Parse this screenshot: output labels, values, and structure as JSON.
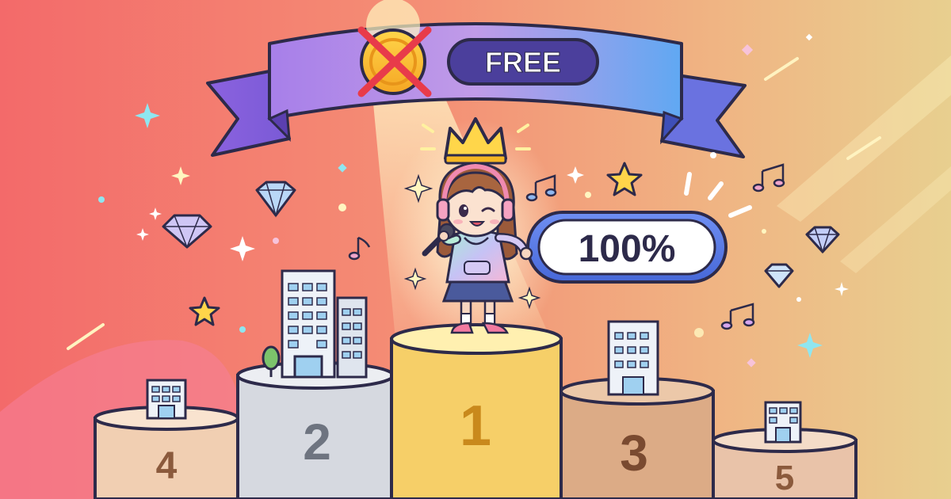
{
  "banner": {
    "coin_status": "crossed-out",
    "free_label": "FREE"
  },
  "rate_badge": {
    "value_label": "100%"
  },
  "podiums": [
    {
      "rank_label": "1",
      "color": "#f7d77a"
    },
    {
      "rank_label": "2",
      "color": "#d9dce3"
    },
    {
      "rank_label": "3",
      "color": "#e3b48d"
    },
    {
      "rank_label": "4",
      "color": "#f2d3b6"
    },
    {
      "rank_label": "5",
      "color": "#eac7ae"
    }
  ],
  "icons": {
    "crown": "crown-icon",
    "coin": "coin-icon",
    "microphone": "microphone-icon",
    "headphones": "headphones-icon",
    "diamond": "diamond-icon",
    "music_note": "music-note-icon",
    "star": "star-icon",
    "building": "building-icon",
    "tree": "tree-icon"
  },
  "colors": {
    "background_left": "#f36b6b",
    "background_right": "#e9c98e",
    "banner_left": "#a07be8",
    "banner_right": "#5fa3f0",
    "badge_fill": "#ffffff",
    "badge_border": "#4a6bd8",
    "outline": "#2d2a4a"
  }
}
